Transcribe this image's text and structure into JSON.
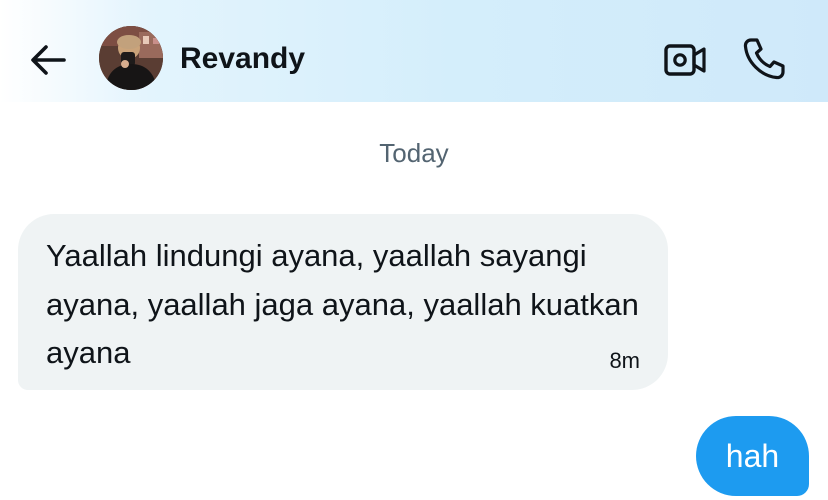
{
  "header": {
    "contact_name": "Revandy",
    "back_icon": "arrow-left-icon",
    "video_icon": "video-camera-icon",
    "call_icon": "phone-icon"
  },
  "conversation": {
    "date_separator": "Today",
    "messages": [
      {
        "direction": "incoming",
        "text": "Yaallah lindungi ayana, yaallah sayangi ayana, yaallah jaga ayana, yaallah kuatkan ayana",
        "time": "8m"
      },
      {
        "direction": "outgoing",
        "text": "hah"
      }
    ]
  },
  "colors": {
    "outgoing_bubble": "#1d9bf0",
    "incoming_bubble": "#eff3f4",
    "primary_text": "#0f1419",
    "secondary_text": "#536471"
  }
}
